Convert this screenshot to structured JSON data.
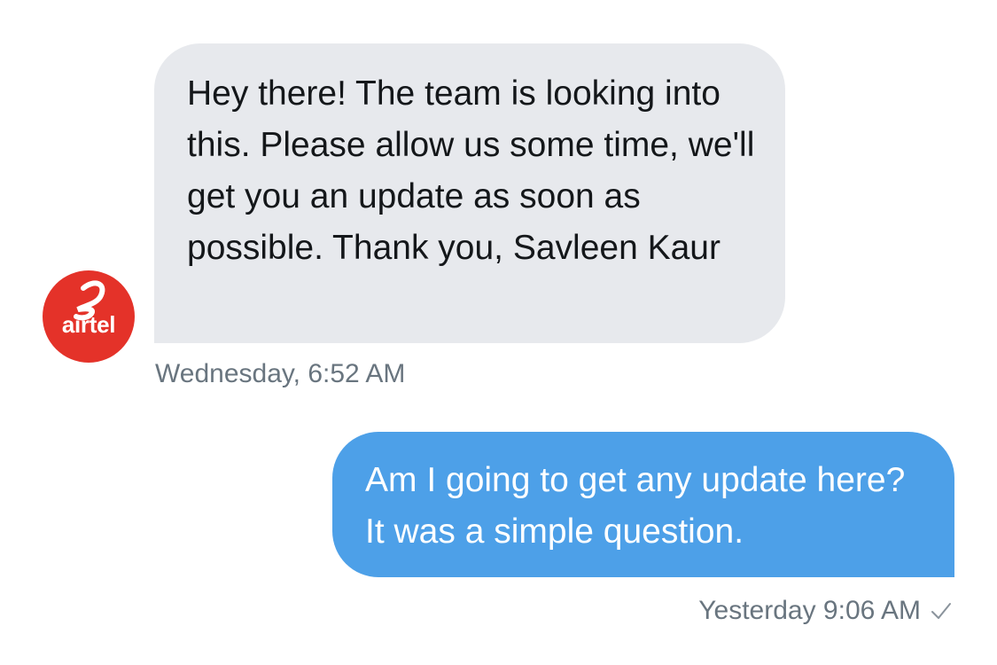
{
  "conversation": {
    "partner": {
      "avatar_text": "airtel",
      "avatar_color": "#e43229"
    },
    "messages": [
      {
        "direction": "incoming",
        "text": "Hey there! The team is looking into this. Please allow us some time, we'll get you an update as soon as possible. Thank you, Savleen Kaur",
        "timestamp": "Wednesday, 6:52 AM",
        "bubble_color": "#e7e9ed"
      },
      {
        "direction": "outgoing",
        "text": "Am I going to get any update here? It was a simple question.",
        "timestamp": "Yesterday 9:06 AM",
        "status_icon": "check-icon",
        "bubble_color": "#4da0e8"
      }
    ]
  }
}
